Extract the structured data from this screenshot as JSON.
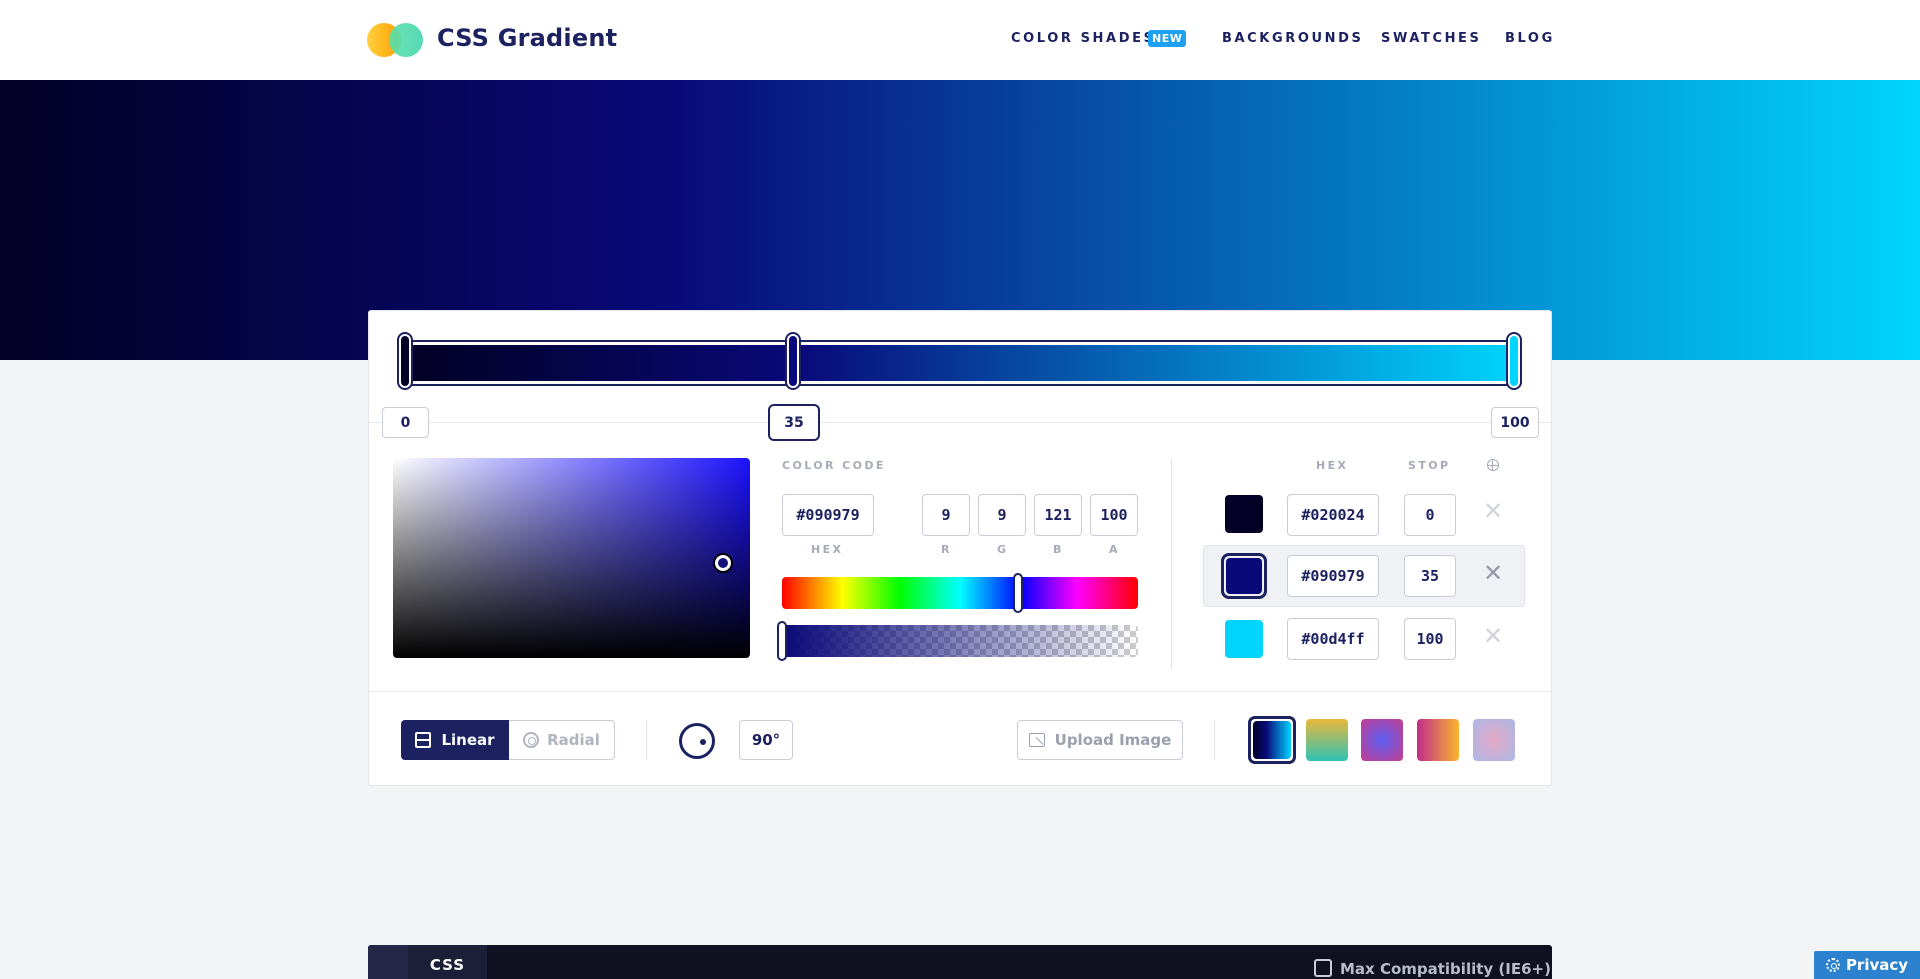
{
  "header": {
    "brand": "CSS Gradient",
    "nav": {
      "color_shades": "COLOR SHADES",
      "new_badge": "NEW",
      "backgrounds": "BACKGROUNDS",
      "swatches": "SWATCHES",
      "blog": "BLOG"
    }
  },
  "gradient": {
    "colors": [
      "#020024",
      "#090979",
      "#00d4ff"
    ],
    "stop_labels": [
      "0",
      "35",
      "100"
    ],
    "active_stop_index": 1
  },
  "picker": {
    "color_code_label": "COLOR CODE",
    "hex_value": "#090979",
    "r": "9",
    "g": "9",
    "b": "121",
    "a": "100",
    "labels": {
      "hex": "HEX",
      "r": "R",
      "g": "G",
      "b": "B",
      "a": "A"
    }
  },
  "stops_table": {
    "hex_header": "HEX",
    "stop_header": "STOP",
    "rows": [
      {
        "hex": "#020024",
        "stop": "0"
      },
      {
        "hex": "#090979",
        "stop": "35"
      },
      {
        "hex": "#00d4ff",
        "stop": "100"
      }
    ]
  },
  "toolbar": {
    "linear_label": "Linear",
    "radial_label": "Radial",
    "angle": "90°",
    "upload_label": "Upload Image"
  },
  "presets": [
    "linear-gradient(90deg,#020024,#090979 35%,#00d4ff)",
    "linear-gradient(180deg,#e9b83b,#2fc2b5)",
    "radial-gradient(circle,#5c5ff4,#c43d8e)",
    "linear-gradient(90deg,#c22d8c,#f8b52b)",
    "radial-gradient(circle,#e6a9c6,#a8b8e8)"
  ],
  "code": {
    "tab_label": "CSS",
    "compat_label": "Max Compatibility (IE6+)"
  },
  "privacy_label": "Privacy"
}
